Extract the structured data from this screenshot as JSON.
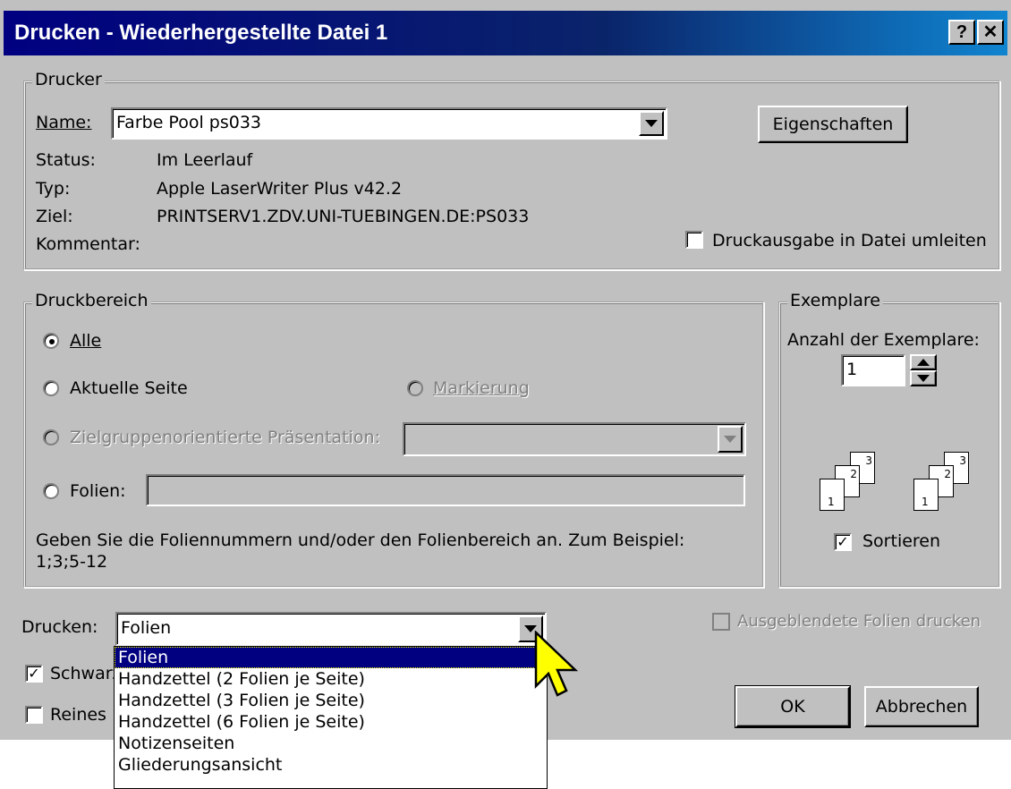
{
  "dialog": {
    "title": "Drucken - Wiederhergestellte Datei 1",
    "help_button": "?",
    "close_button": "✕"
  },
  "drucker": {
    "legend": "Drucker",
    "name_label": "Name:",
    "name_value": "Farbe Pool ps033",
    "properties_button": "Eigenschaften",
    "status_label": "Status:",
    "status_value": "Im Leerlauf",
    "typ_label": "Typ:",
    "typ_value": "Apple LaserWriter Plus v42.2",
    "ziel_label": "Ziel:",
    "ziel_value": "PRINTSERV1.ZDV.UNI-TUEBINGEN.DE:PS033",
    "kommentar_label": "Kommentar:",
    "redirect_label": "Druckausgabe in Datei umleiten",
    "redirect_checked": false
  },
  "druckbereich": {
    "legend": "Druckbereich",
    "option_alle": "Alle",
    "option_aktuelle": "Aktuelle Seite",
    "option_markierung": "Markierung",
    "option_zielgruppen": "Zielgruppenorientierte Präsentation:",
    "option_folien": "Folien:",
    "selected": "Alle",
    "hint": "Geben Sie die Foliennummern und/oder den Folienbereich an. Zum Beispiel:",
    "hint_example": "1;3;5-12"
  },
  "exemplare": {
    "legend": "Exemplare",
    "count_label": "Anzahl der Exemplare:",
    "count_value": "1",
    "sort_label": "Sortieren",
    "sort_checked": true,
    "page_numbers": [
      "1",
      "2",
      "3"
    ]
  },
  "bottom": {
    "drucken_label": "Drucken:",
    "drucken_value": "Folien",
    "hidden_slides_label": "Ausgeblendete Folien drucken",
    "schwarz_label": "Schwarz",
    "reines_label": "Reines",
    "ok_button": "OK",
    "cancel_button": "Abbrechen"
  },
  "dropdown": {
    "options": [
      "Folien",
      "Handzettel (2 Folien je Seite)",
      "Handzettel (3 Folien je Seite)",
      "Handzettel (6 Folien je Seite)",
      "Notizenseiten",
      "Gliederungsansicht"
    ],
    "selected_index": 0
  },
  "colors": {
    "titlebar": "#000080",
    "dialog_bg": "#c0c0c0",
    "selection": "#000080",
    "cursor": "#ffff00"
  }
}
